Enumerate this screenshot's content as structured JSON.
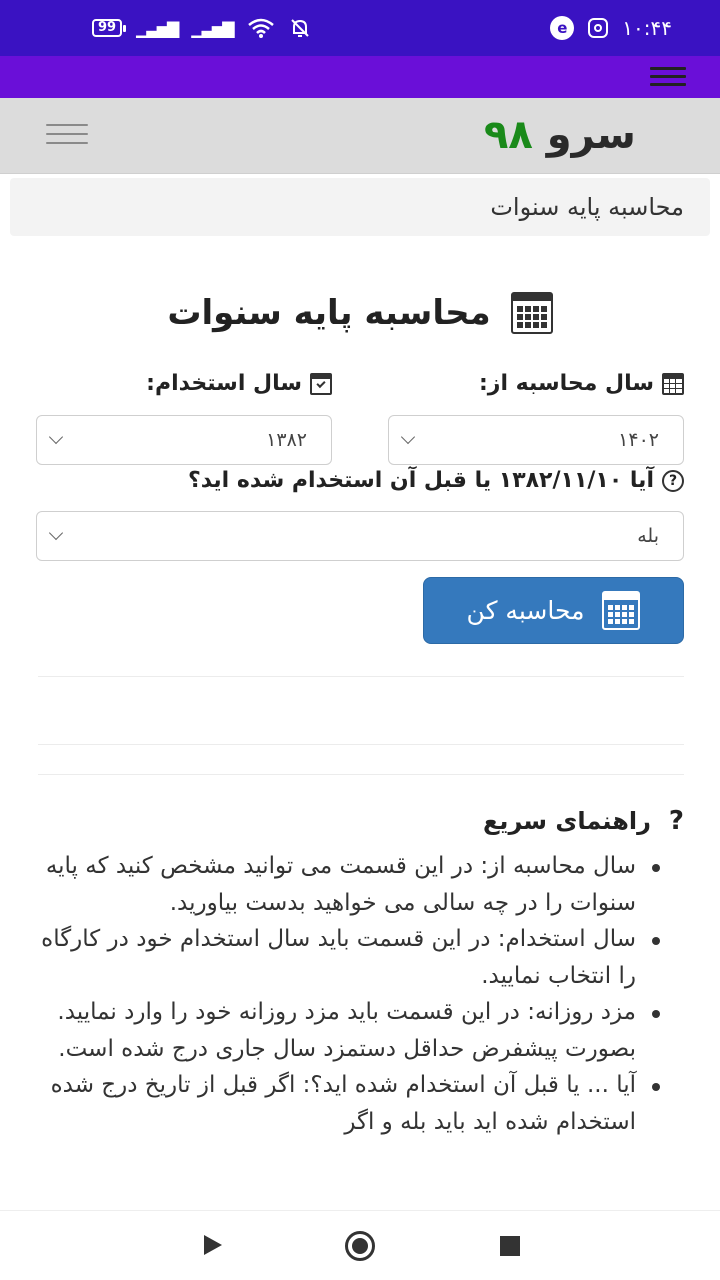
{
  "status_bar": {
    "battery": "99",
    "time": "۱۰:۴۴"
  },
  "site": {
    "logo_text": "سرو",
    "logo_number": "۹۸"
  },
  "breadcrumb": "محاسبه پایه سنوات",
  "page_title": "محاسبه پایه سنوات",
  "form": {
    "calc_year_label": "سال محاسبه از:",
    "calc_year_value": "۱۴۰۲",
    "hire_year_label": "سال استخدام:",
    "hire_year_value": "۱۳۸۲",
    "question_label": "آیا ۱۳۸۲/۱۱/۱۰ یا قبل آن استخدام شده اید؟",
    "question_value": "بله",
    "submit_label": "محاسبه کن"
  },
  "guide": {
    "title": "راهنمای سریع",
    "q_mark": "?",
    "items": [
      "سال محاسبه از: در این قسمت می توانید مشخص کنید که پایه سنوات را در چه سالی می خواهید بدست بیاورید.",
      "سال استخدام: در این قسمت باید سال استخدام خود در کارگاه را انتخاب نمایید.",
      "مزد روزانه: در این قسمت باید مزد روزانه خود را وارد نمایید. بصورت پیشفرض حداقل دستمزد سال جاری درج شده است.",
      "آیا ... یا قبل آن استخدام شده اید؟: اگر قبل از تاریخ درج شده استخدام شده اید باید بله و اگر"
    ]
  },
  "icons": {
    "status": [
      "battery-icon",
      "signal-icon",
      "wifi-icon",
      "mute-icon",
      "browser-icon",
      "instagram-icon"
    ],
    "nav": [
      "back-icon",
      "home-icon",
      "recents-icon"
    ]
  },
  "colors": {
    "status_bar": "#3a12c2",
    "app_bar": "#6a0fd8",
    "button": "#3579bd",
    "logo_number": "#1a8a1a"
  }
}
